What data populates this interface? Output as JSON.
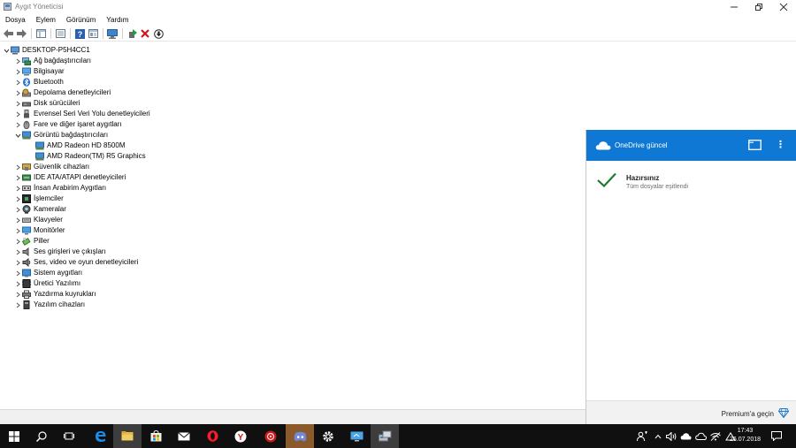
{
  "window": {
    "title": "Aygıt Yöneticisi",
    "controls": {
      "minimize": "—",
      "restore": "❐",
      "close": "✕"
    }
  },
  "menu": [
    "Dosya",
    "Eylem",
    "Görünüm",
    "Yardım"
  ],
  "toolbar": {
    "icons": [
      "back-arrow-icon",
      "forward-arrow-icon",
      "properties-panel-icon",
      "list-view-icon",
      "help-icon",
      "details-view-icon",
      "monitor-scan-icon",
      "update-driver-icon",
      "uninstall-x-icon",
      "download-icon"
    ]
  },
  "tree": {
    "root": "DESKTOP-P5H4CC1",
    "categories": [
      {
        "label": "Ağ bağdaştırıcıları",
        "icon": "network-adapter-icon",
        "expanded": false
      },
      {
        "label": "Bilgisayar",
        "icon": "computer-icon",
        "expanded": false
      },
      {
        "label": "Bluetooth",
        "icon": "bluetooth-icon",
        "expanded": false
      },
      {
        "label": "Depolama denetleyicileri",
        "icon": "storage-controller-icon",
        "expanded": false
      },
      {
        "label": "Disk sürücüleri",
        "icon": "disk-drive-icon",
        "expanded": false
      },
      {
        "label": "Evrensel Seri Veri Yolu denetleyicileri",
        "icon": "usb-icon",
        "expanded": false
      },
      {
        "label": "Fare ve diğer işaret aygıtları",
        "icon": "mouse-icon",
        "expanded": false
      },
      {
        "label": "Görüntü bağdaştırıcıları",
        "icon": "display-adapter-icon",
        "expanded": true,
        "children": [
          "AMD Radeon HD 8500M",
          "AMD Radeon(TM) R5 Graphics"
        ]
      },
      {
        "label": "Güvenlik cihazları",
        "icon": "security-device-icon",
        "expanded": false
      },
      {
        "label": "IDE ATA/ATAPI denetleyicileri",
        "icon": "ide-controller-icon",
        "expanded": false
      },
      {
        "label": "İnsan Arabirim Aygıtları",
        "icon": "hid-icon",
        "expanded": false
      },
      {
        "label": "İşlemciler",
        "icon": "processor-icon",
        "expanded": false
      },
      {
        "label": "Kameralar",
        "icon": "camera-icon",
        "expanded": false
      },
      {
        "label": "Klavyeler",
        "icon": "keyboard-icon",
        "expanded": false
      },
      {
        "label": "Monitörler",
        "icon": "monitor-icon",
        "expanded": false
      },
      {
        "label": "Piller",
        "icon": "battery-icon",
        "expanded": false
      },
      {
        "label": "Ses girişleri ve çıkışları",
        "icon": "audio-io-icon",
        "expanded": false
      },
      {
        "label": "Ses, video ve oyun denetleyicileri",
        "icon": "sound-controller-icon",
        "expanded": false
      },
      {
        "label": "Sistem aygıtları",
        "icon": "system-device-icon",
        "expanded": false
      },
      {
        "label": "Üretici Yazılımı",
        "icon": "firmware-icon",
        "expanded": false
      },
      {
        "label": "Yazdırma kuyrukları",
        "icon": "print-queue-icon",
        "expanded": false
      },
      {
        "label": "Yazılım cihazları",
        "icon": "software-device-icon",
        "expanded": false
      }
    ]
  },
  "onedrive": {
    "title": "OneDrive güncel",
    "status": "Hazırsınız",
    "substatus": "Tüm dosyalar eşitlendi",
    "premium": "Premium'a geçin",
    "more": "⋮",
    "accent": "#0f78d4"
  },
  "taskbar": {
    "apps": [
      "start-icon",
      "search-icon",
      "task-view-icon",
      "edge-icon",
      "file-explorer-icon",
      "store-icon",
      "mail-icon",
      "opera-icon",
      "yandex-icon",
      "vivaldi-icon",
      "discord-icon",
      "settings-icon",
      "remote-desktop-icon",
      "device-manager-icon"
    ],
    "time": "17:43",
    "date": "26.07.2018"
  }
}
